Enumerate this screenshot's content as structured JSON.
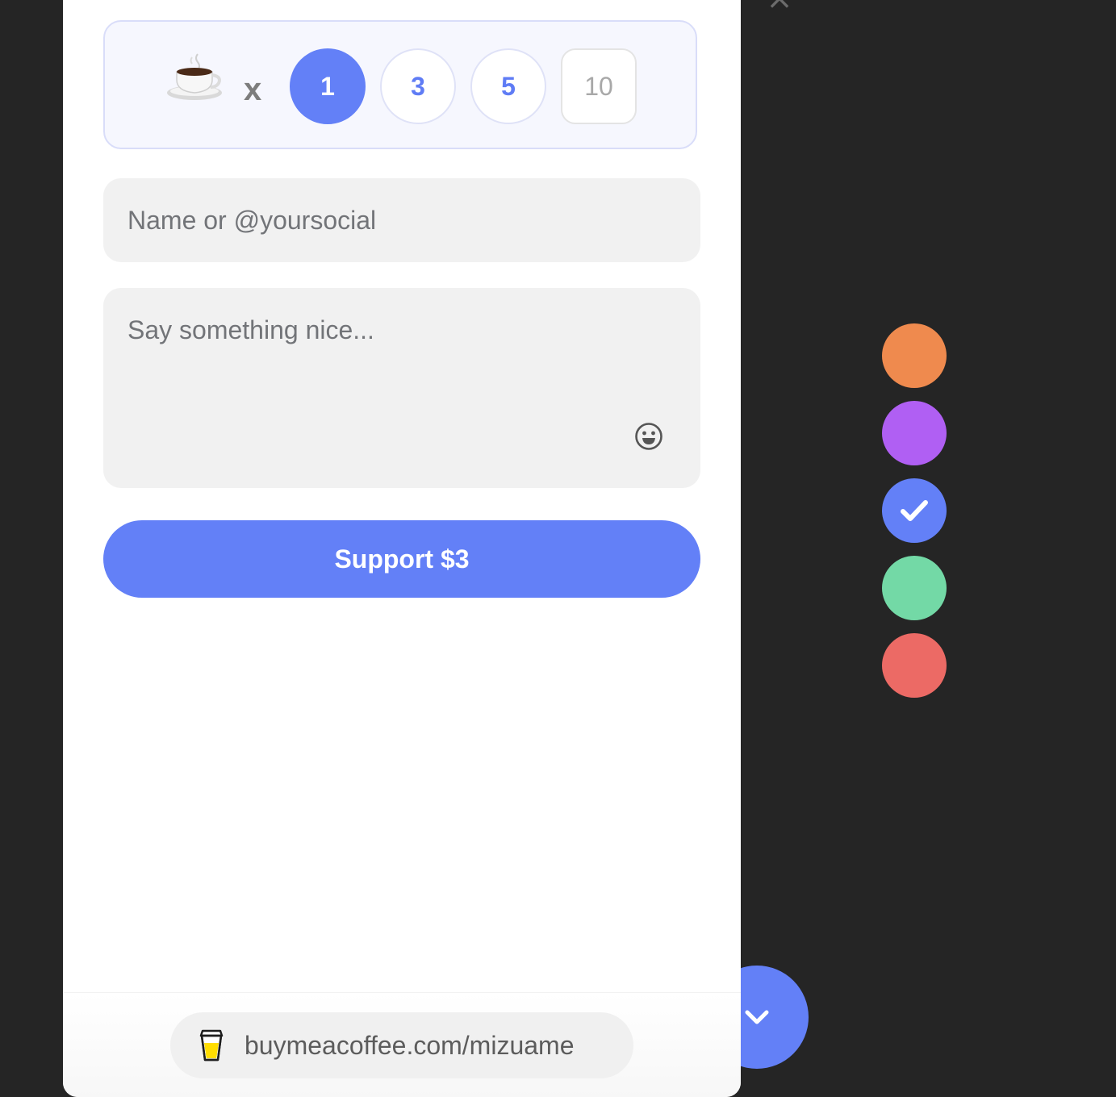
{
  "widget": {
    "times_symbol": "x",
    "quantities": [
      {
        "label": "1",
        "selected": true
      },
      {
        "label": "3",
        "selected": false
      },
      {
        "label": "5",
        "selected": false
      }
    ],
    "custom_quantity_placeholder": "10",
    "name_placeholder": "Name or @yoursocial",
    "message_placeholder": "Say something nice...",
    "support_label": "Support $3",
    "footer_link": "buymeacoffee.com/mizuame",
    "accent_color": "#6380f7"
  },
  "color_swatches": [
    {
      "name": "orange",
      "color": "#ef8a4e",
      "selected": false
    },
    {
      "name": "purple",
      "color": "#b05ff3",
      "selected": false
    },
    {
      "name": "blue",
      "color": "#6380f7",
      "selected": true
    },
    {
      "name": "green",
      "color": "#73d9a6",
      "selected": false
    },
    {
      "name": "red",
      "color": "#ec6a65",
      "selected": false
    }
  ],
  "icons": [
    "close-icon",
    "coffee-cup-icon",
    "smiley-icon",
    "bmc-cup-icon",
    "checkmark-icon",
    "chevron-down-icon"
  ]
}
